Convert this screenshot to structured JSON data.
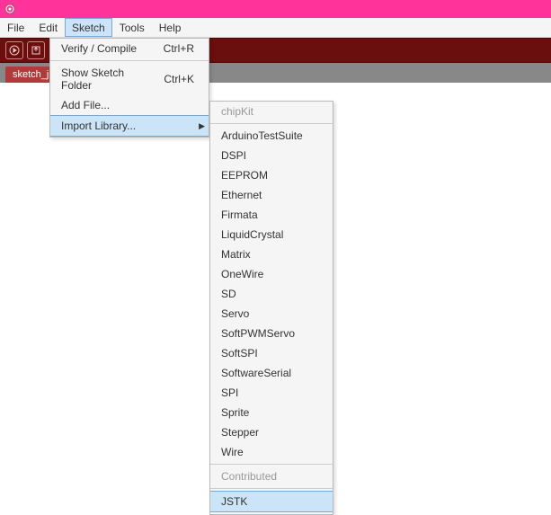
{
  "menubar": {
    "items": [
      "File",
      "Edit",
      "Sketch",
      "Tools",
      "Help"
    ]
  },
  "tab": {
    "label": "sketch_j"
  },
  "sketch_menu": {
    "verify": {
      "label": "Verify / Compile",
      "shortcut": "Ctrl+R"
    },
    "show_folder": {
      "label": "Show Sketch Folder",
      "shortcut": "Ctrl+K"
    },
    "add_file": {
      "label": "Add File..."
    },
    "import_library": {
      "label": "Import Library..."
    }
  },
  "library_menu": {
    "header1": "chipKit",
    "items": [
      "ArduinoTestSuite",
      "DSPI",
      "EEPROM",
      "Ethernet",
      "Firmata",
      "LiquidCrystal",
      "Matrix",
      "OneWire",
      "SD",
      "Servo",
      "SoftPWMServo",
      "SoftSPI",
      "SoftwareSerial",
      "SPI",
      "Sprite",
      "Stepper",
      "Wire"
    ],
    "header2": "Contributed",
    "contributed": [
      "JSTK"
    ]
  }
}
